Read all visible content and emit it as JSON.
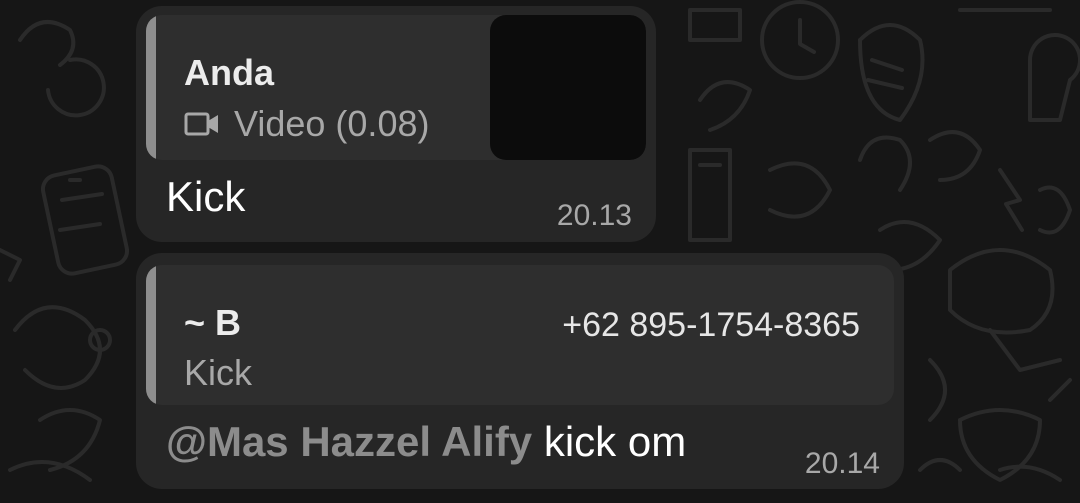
{
  "messages": [
    {
      "quote": {
        "sender": "Anda",
        "content_icon": "video-camera-icon",
        "content": "Video (0.08)",
        "has_thumbnail": true
      },
      "text": "Kick",
      "time": "20.13"
    },
    {
      "quote": {
        "sender": "~ B",
        "phone": "+62 895-1754-8365",
        "content": "Kick"
      },
      "mention": "@Mas Hazzel Alify",
      "text": " kick om",
      "time": "20.14"
    }
  ],
  "colors": {
    "background": "#161616",
    "bubble": "#262626",
    "quote_bg": "#2e2e2e",
    "quote_bar": "#8e8e8e",
    "muted_text": "#a8a8a8",
    "mention": "#8c8c8c"
  }
}
